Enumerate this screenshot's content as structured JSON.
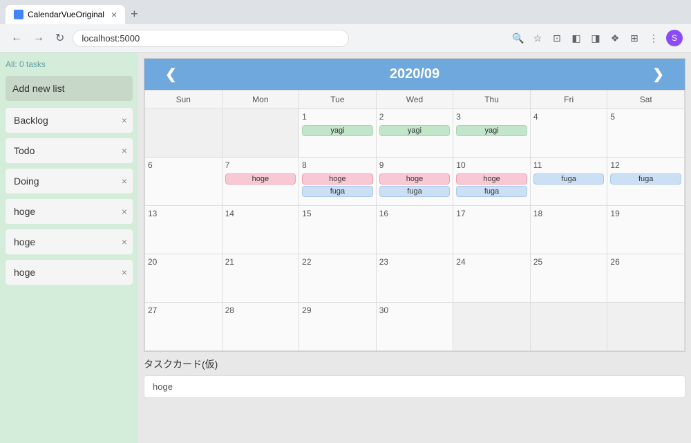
{
  "browser": {
    "tab_title": "CalendarVueOriginal",
    "tab_close": "×",
    "tab_new": "+",
    "nav_back": "←",
    "nav_forward": "→",
    "nav_refresh": "↻",
    "address": "localhost:5000",
    "profile_letter": "S"
  },
  "sidebar": {
    "status": "All: 0 tasks",
    "add_btn_label": "Add new list",
    "lists": [
      {
        "label": "Backlog"
      },
      {
        "label": "Todo"
      },
      {
        "label": "Doing"
      },
      {
        "label": "hoge"
      },
      {
        "label": "hoge"
      },
      {
        "label": "hoge"
      }
    ]
  },
  "calendar": {
    "prev_btn": "❮",
    "next_btn": "❯",
    "title": "2020/09",
    "day_headers": [
      "Sun",
      "Mon",
      "Tue",
      "Wed",
      "Thu",
      "Fri",
      "Sat"
    ],
    "weeks": [
      [
        {
          "number": "",
          "empty": true
        },
        {
          "number": "",
          "empty": true
        },
        {
          "number": "1",
          "events": [
            {
              "label": "yagi",
              "type": "green"
            }
          ]
        },
        {
          "number": "2",
          "events": [
            {
              "label": "yagi",
              "type": "green"
            }
          ]
        },
        {
          "number": "3",
          "events": [
            {
              "label": "yagi",
              "type": "green"
            }
          ]
        },
        {
          "number": "4",
          "events": []
        },
        {
          "number": "5",
          "events": []
        }
      ],
      [
        {
          "number": "6",
          "events": []
        },
        {
          "number": "7",
          "events": [
            {
              "label": "hoge",
              "type": "pink"
            }
          ]
        },
        {
          "number": "8",
          "events": [
            {
              "label": "hoge",
              "type": "pink"
            },
            {
              "label": "fuga",
              "type": "blue"
            }
          ]
        },
        {
          "number": "9",
          "events": [
            {
              "label": "hoge",
              "type": "pink"
            },
            {
              "label": "fuga",
              "type": "blue"
            }
          ]
        },
        {
          "number": "10",
          "events": [
            {
              "label": "hoge",
              "type": "pink"
            },
            {
              "label": "fuga",
              "type": "blue"
            }
          ]
        },
        {
          "number": "11",
          "events": [
            {
              "label": "fuga",
              "type": "blue"
            }
          ]
        },
        {
          "number": "12",
          "events": [
            {
              "label": "fuga",
              "type": "blue"
            }
          ]
        }
      ],
      [
        {
          "number": "13",
          "events": []
        },
        {
          "number": "14",
          "events": []
        },
        {
          "number": "15",
          "events": []
        },
        {
          "number": "16",
          "events": []
        },
        {
          "number": "17",
          "events": []
        },
        {
          "number": "18",
          "events": []
        },
        {
          "number": "19",
          "events": []
        }
      ],
      [
        {
          "number": "20",
          "events": []
        },
        {
          "number": "21",
          "events": []
        },
        {
          "number": "22",
          "events": []
        },
        {
          "number": "23",
          "events": []
        },
        {
          "number": "24",
          "events": []
        },
        {
          "number": "25",
          "events": []
        },
        {
          "number": "26",
          "events": []
        }
      ],
      [
        {
          "number": "27",
          "events": []
        },
        {
          "number": "28",
          "events": []
        },
        {
          "number": "29",
          "events": []
        },
        {
          "number": "30",
          "events": []
        },
        {
          "number": "",
          "empty": true
        },
        {
          "number": "",
          "empty": true
        },
        {
          "number": "",
          "empty": true
        }
      ]
    ]
  },
  "task_card": {
    "title": "タスクカード(仮)",
    "input_value": "hoge",
    "input_placeholder": "hoge"
  }
}
